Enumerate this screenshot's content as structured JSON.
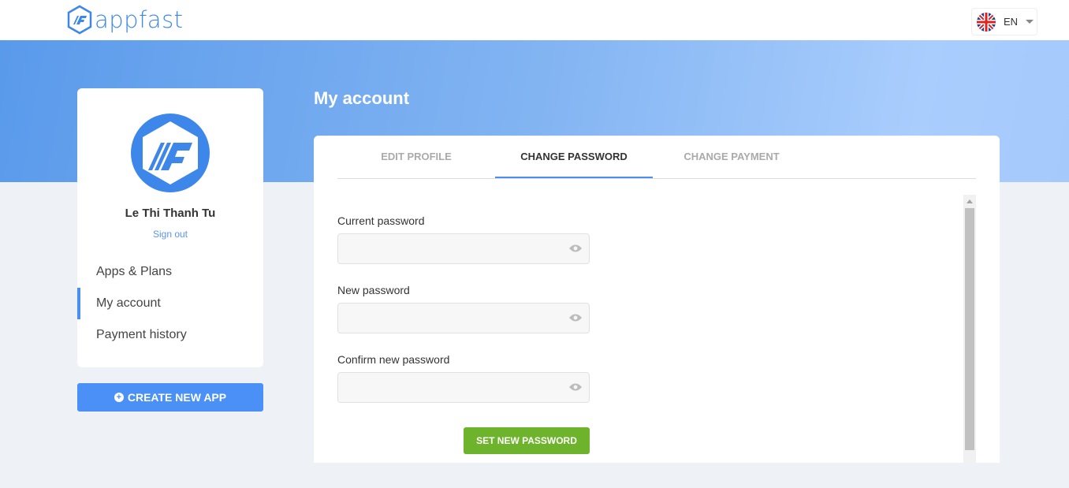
{
  "header": {
    "logo_text": "appfast",
    "language": "EN",
    "brand_color": "#3d86ea"
  },
  "sidebar": {
    "user_name": "Le Thi Thanh Tu",
    "sign_out": "Sign out",
    "items": [
      {
        "label": "Apps & Plans"
      },
      {
        "label": "My account",
        "active": true
      },
      {
        "label": "Payment history"
      }
    ],
    "create_button": "CREATE NEW APP"
  },
  "main": {
    "title": "My account",
    "tabs": [
      {
        "label": "EDIT PROFILE"
      },
      {
        "label": "CHANGE PASSWORD",
        "active": true
      },
      {
        "label": "CHANGE PAYMENT"
      }
    ],
    "form": {
      "current_label": "Current password",
      "current_value": "",
      "new_label": "New password",
      "new_value": "",
      "confirm_label": "Confirm new password",
      "confirm_value": "",
      "submit": "SET NEW PASSWORD"
    }
  }
}
